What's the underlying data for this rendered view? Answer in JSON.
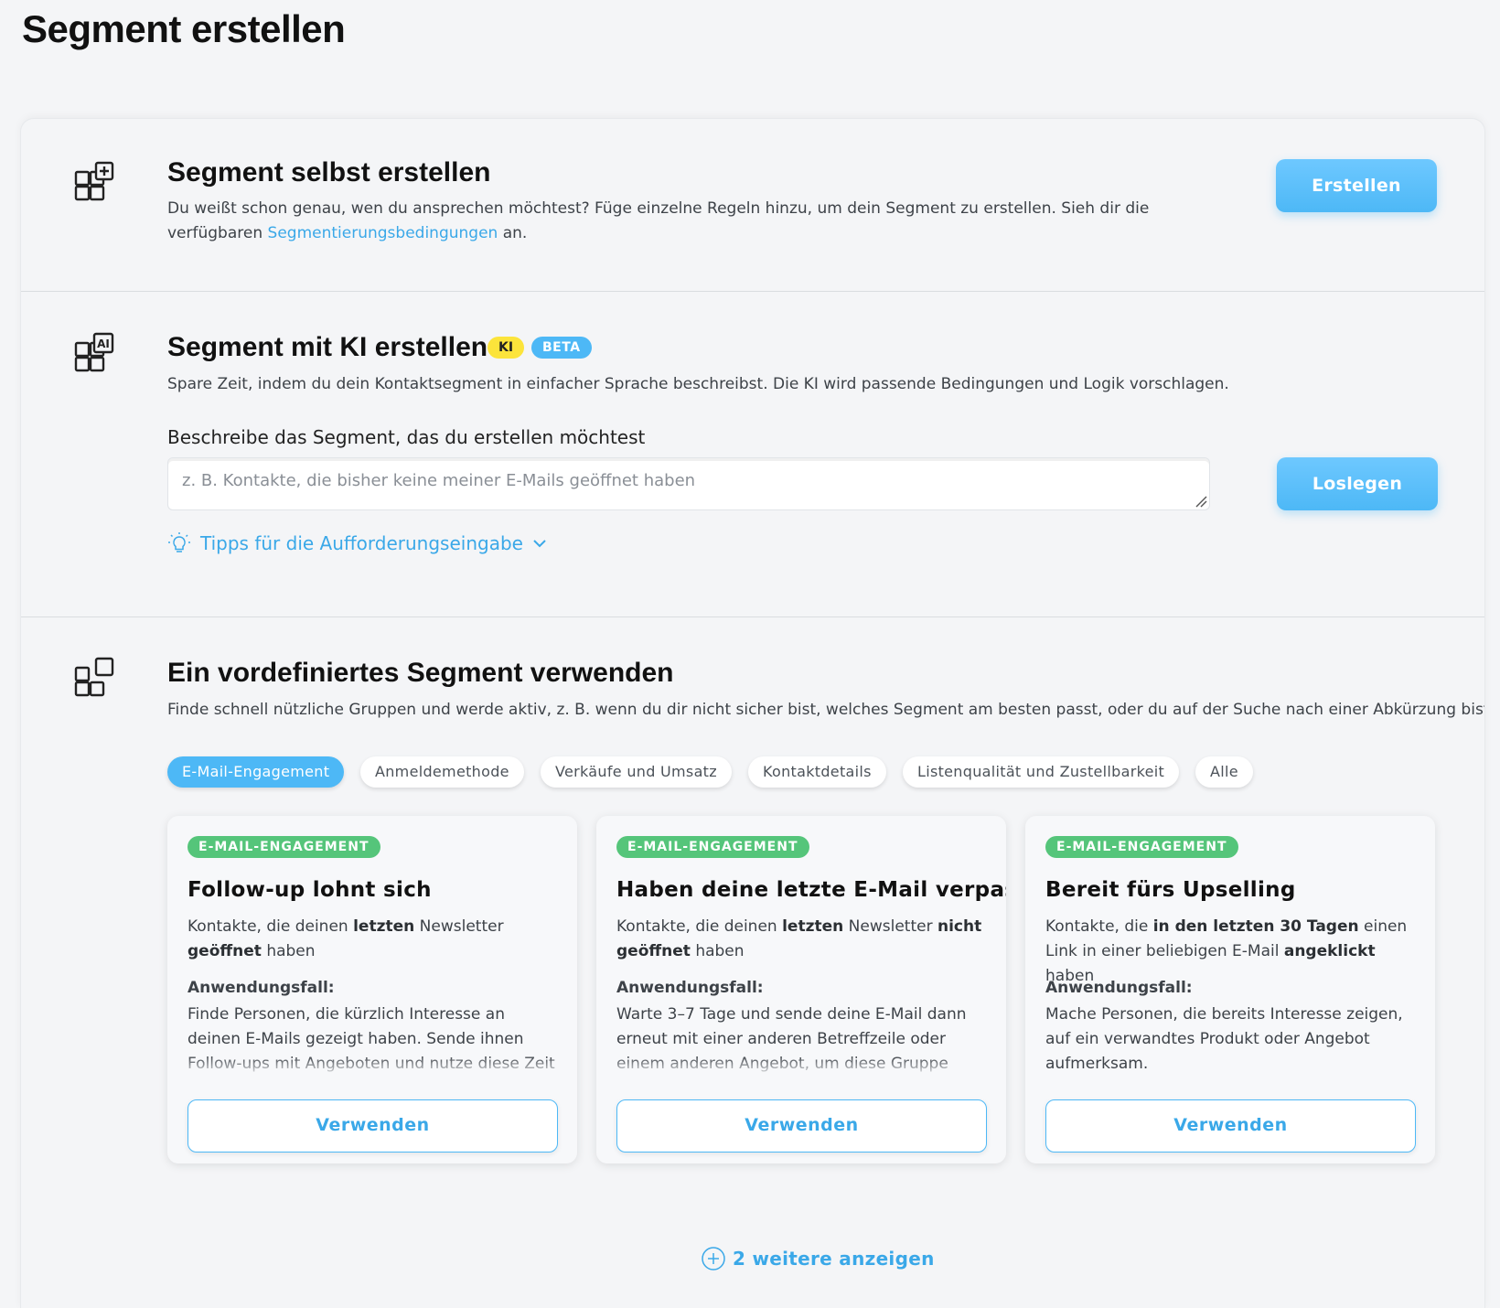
{
  "page": {
    "title": "Segment erstellen"
  },
  "section_custom": {
    "icon": "grid-plus-icon",
    "title": "Segment selbst erstellen",
    "desc_before": "Du weißt schon genau, wen du ansprechen möchtest? Füge einzelne Regeln hinzu, um dein Segment zu erstellen. Sieh dir die verfügbaren ",
    "desc_link": "Segmentierungsbedingungen",
    "desc_after": " an.",
    "button": "Erstellen"
  },
  "section_ai": {
    "icon": "grid-ai-icon",
    "title": "Segment mit KI erstellen",
    "badge_ki": "KI",
    "badge_beta": "BETA",
    "desc": "Spare Zeit, indem du dein Kontaktsegment in einfacher Sprache beschreibst. Die KI wird passende Bedingungen und Logik vorschlagen.",
    "input_label": "Beschreibe das Segment, das du erstellen möchtest",
    "input_placeholder": "z. B. Kontakte, die bisher keine meiner E-Mails geöffnet haben",
    "input_value": "",
    "button": "Loslegen",
    "tips_label": "Tipps für die Aufforderungseingabe"
  },
  "section_predefined": {
    "icon": "grid-square-icon",
    "title": "Ein vordefiniertes Segment verwenden",
    "desc": "Finde schnell nützliche Gruppen und werde aktiv, z. B. wenn du dir nicht sicher bist, welches Segment am besten passt, oder du auf der Suche nach einer Abkürzung bist.",
    "filters": [
      {
        "label": "E-Mail-Engagement",
        "active": true
      },
      {
        "label": "Anmeldemethode",
        "active": false
      },
      {
        "label": "Verkäufe und Umsatz",
        "active": false
      },
      {
        "label": "Kontaktdetails",
        "active": false
      },
      {
        "label": "Listenqualität und Zustellbarkeit",
        "active": false
      },
      {
        "label": "Alle",
        "active": false
      }
    ],
    "cards": [
      {
        "badge": "E-MAIL-ENGAGEMENT",
        "title": "Follow-up lohnt sich",
        "desc": [
          {
            "t": "Kontakte, die deinen ",
            "b": false
          },
          {
            "t": "letzten",
            "b": true
          },
          {
            "t": " Newsletter ",
            "b": false
          },
          {
            "t": "geöffnet",
            "b": true
          },
          {
            "t": " haben",
            "b": false
          }
        ],
        "use_label": "Anwendungsfall:",
        "use_text": "Finde Personen, die kürzlich Interesse an deinen E-Mails gezeigt haben. Sende ihnen Follow-ups mit Angeboten und nutze diese Zeit der erhöhten Einbindung.",
        "button": "Verwenden"
      },
      {
        "badge": "E-MAIL-ENGAGEMENT",
        "title": "Haben deine letzte E-Mail verpasst",
        "desc": [
          {
            "t": "Kontakte, die deinen ",
            "b": false
          },
          {
            "t": "letzten",
            "b": true
          },
          {
            "t": " Newsletter ",
            "b": false
          },
          {
            "t": "nicht geöffnet",
            "b": true
          },
          {
            "t": " haben",
            "b": false
          }
        ],
        "use_label": "Anwendungsfall:",
        "use_text": "Warte 3–7 Tage und sende deine E-Mail dann erneut mit einer anderen Betreffzeile oder einem anderen Angebot, um diese Gruppe erneut einzubinden.",
        "button": "Verwenden"
      },
      {
        "badge": "E-MAIL-ENGAGEMENT",
        "title": "Bereit fürs Upselling",
        "desc": [
          {
            "t": "Kontakte, die ",
            "b": false
          },
          {
            "t": "in den letzten 30 Tagen",
            "b": true
          },
          {
            "t": " einen Link in einer beliebigen E-Mail ",
            "b": false
          },
          {
            "t": "angeklickt",
            "b": true
          },
          {
            "t": " haben",
            "b": false
          }
        ],
        "use_label": "Anwendungsfall:",
        "use_text": "Mache Personen, die bereits Interesse zeigen, auf ein verwandtes Produkt oder Angebot aufmerksam.",
        "button": "Verwenden"
      }
    ],
    "more_link": "2 weitere anzeigen"
  },
  "colors": {
    "accent": "#4db8f6",
    "link": "#3aa8e8",
    "ki_badge": "#fce43b",
    "engagement_badge": "#55c57a"
  }
}
